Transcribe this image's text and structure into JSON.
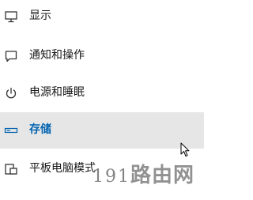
{
  "menu": {
    "items": [
      {
        "label": "显示",
        "icon": "display-icon",
        "selected": false
      },
      {
        "label": "通知和操作",
        "icon": "notification-icon",
        "selected": false
      },
      {
        "label": "电源和睡眠",
        "icon": "power-icon",
        "selected": false
      },
      {
        "label": "存储",
        "icon": "storage-icon",
        "selected": true
      },
      {
        "label": "平板电脑模式",
        "icon": "tablet-mode-icon",
        "selected": false
      }
    ]
  },
  "watermark": {
    "number": "191",
    "text": "路由网"
  },
  "colors": {
    "selected_background": "#e6e6e6",
    "selected_text": "#0063b1",
    "text": "#1a1a1a",
    "icon": "#333333"
  }
}
